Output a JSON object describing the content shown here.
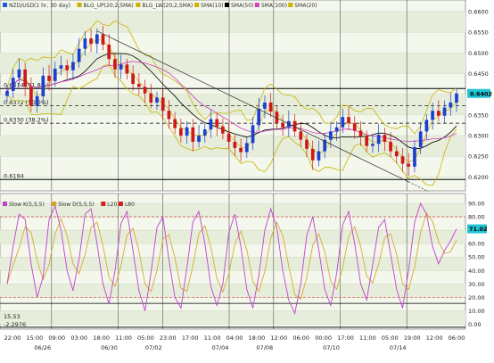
{
  "chart_data": [
    {
      "panel": "price",
      "type": "candlestick",
      "title": "NZD/USD(1 hr, 30 day)",
      "legend": [
        {
          "name": "NZD/USD(1 hr, 30 day)",
          "color": "#1e5fd6"
        },
        {
          "name": "BLG_UP(20,2,SMA)",
          "color": "#c8b400"
        },
        {
          "name": "BLG_LW(20,2,SMA)",
          "color": "#c8b400"
        },
        {
          "name": "SMA(10)",
          "color": "#c8b400"
        },
        {
          "name": "SMA(50)",
          "color": "#000000"
        },
        {
          "name": "SMA(100)",
          "color": "#d040c0"
        },
        {
          "name": "SMA(20)",
          "color": "#c8b400"
        }
      ],
      "y_ticks": [
        "0.6600",
        "0.6550",
        "0.6500",
        "0.6450",
        "0.6400",
        "0.6350",
        "0.6300",
        "0.6250",
        "0.6200"
      ],
      "ylim": [
        0.6175,
        0.6615
      ],
      "last_price_tag": "0.6402",
      "last_price": 0.6402,
      "horizontal_levels": [
        {
          "label": "0.6414 (61.8%)",
          "value": 0.6414,
          "style": "solid"
        },
        {
          "label": "0.6372 (50.0%)",
          "value": 0.6372,
          "style": "dashed"
        },
        {
          "label": "0.6330 (38.2%)",
          "value": 0.633,
          "style": "dashed"
        },
        {
          "label": "0.6194",
          "value": 0.6194,
          "style": "solid"
        }
      ],
      "trendline": {
        "from": 0.6553,
        "to": 0.618
      },
      "close_series": [
        0.6408,
        0.644,
        0.646,
        0.6418,
        0.6372,
        0.6395,
        0.6445,
        0.6432,
        0.6462,
        0.647,
        0.6458,
        0.6478,
        0.651,
        0.6535,
        0.6522,
        0.6545,
        0.652,
        0.6485,
        0.646,
        0.6472,
        0.645,
        0.6425,
        0.6418,
        0.6402,
        0.638,
        0.6392,
        0.636,
        0.634,
        0.6318,
        0.63,
        0.632,
        0.6285,
        0.63,
        0.6315,
        0.634,
        0.6322,
        0.6305,
        0.6285,
        0.627,
        0.626,
        0.6282,
        0.6325,
        0.6365,
        0.638,
        0.6358,
        0.633,
        0.632,
        0.6335,
        0.631,
        0.629,
        0.6268,
        0.624,
        0.6262,
        0.629,
        0.631,
        0.632,
        0.6345,
        0.633,
        0.6312,
        0.6298,
        0.6275,
        0.628,
        0.6302,
        0.6285,
        0.6262,
        0.625,
        0.6232,
        0.6225,
        0.6272,
        0.631,
        0.6338,
        0.636,
        0.6348,
        0.6368,
        0.638,
        0.6402
      ]
    },
    {
      "panel": "oscillator",
      "type": "line",
      "legend": [
        {
          "name": "Slow K(5,5,5)",
          "color": "#c040d0"
        },
        {
          "name": "Slow D(5,5,5)",
          "color": "#d8a020"
        },
        {
          "name": "L20",
          "color": "#d02020"
        },
        {
          "name": "L80",
          "color": "#d02020"
        }
      ],
      "y_ticks": [
        "90.00",
        "80.00",
        "70.00",
        "60.00",
        "50.00",
        "40.00",
        "30.00",
        "20.00",
        "10.00",
        "0.00"
      ],
      "ylim": [
        -3,
        94
      ],
      "last_value_tag": "71.02",
      "last_value": 71.02,
      "level_labels": [
        {
          "label": "15.53",
          "value": 15.53
        },
        {
          "label": "-2.2976",
          "value": -2.2976
        }
      ],
      "reference_lines": [
        {
          "name": "L80",
          "value": 80
        },
        {
          "name": "L20",
          "value": 20
        }
      ],
      "slow_k": [
        30,
        58,
        82,
        78,
        45,
        20,
        35,
        78,
        88,
        70,
        40,
        25,
        48,
        82,
        86,
        60,
        30,
        15,
        40,
        75,
        84,
        55,
        25,
        10,
        38,
        72,
        80,
        48,
        20,
        12,
        42,
        76,
        84,
        60,
        28,
        14,
        30,
        68,
        82,
        58,
        26,
        12,
        36,
        70,
        86,
        72,
        40,
        18,
        8,
        30,
        66,
        80,
        56,
        26,
        14,
        38,
        74,
        84,
        60,
        30,
        18,
        44,
        72,
        78,
        52,
        26,
        12,
        40,
        76,
        90,
        82,
        58,
        45,
        55,
        62,
        71
      ]
    }
  ],
  "x_labels": [
    "22:00",
    "15:00",
    "09:00",
    "03:00",
    "18:00",
    "11:00",
    "05:00",
    "23:00",
    "17:00",
    "11:00",
    "04:00",
    "18:00",
    "12:00",
    "06:00",
    "00:00",
    "17:00",
    "11:00",
    "05:00",
    "19:00",
    "12:00",
    "06:00"
  ],
  "date_labels": [
    "06/26",
    "06/30",
    "07/02",
    "07/04",
    "07/08",
    "07/10",
    "07/14"
  ]
}
